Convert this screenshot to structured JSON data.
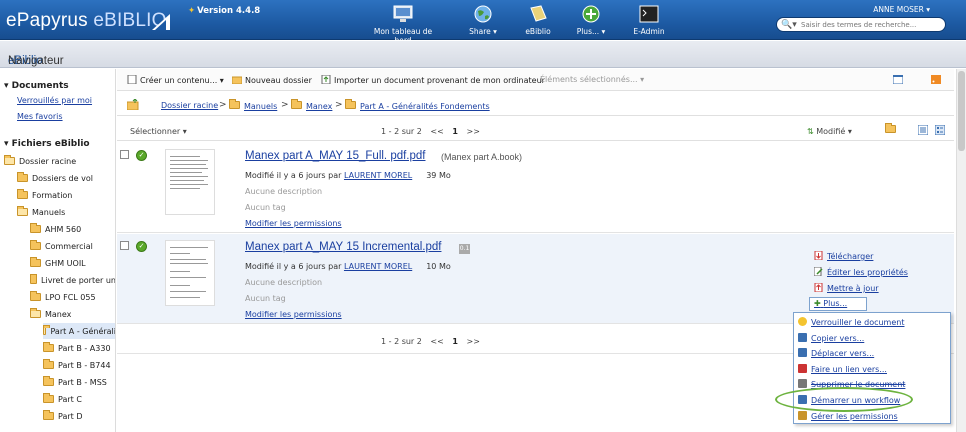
{
  "app": {
    "brand_a": "ePapyrus ",
    "brand_b": "eBIBLIO",
    "version": "Version 4.4.8"
  },
  "topnav": [
    {
      "label": "Mon tableau de bord",
      "icon": "monitor-icon"
    },
    {
      "label": "Share",
      "icon": "globe-icon"
    },
    {
      "label": "eBiblio",
      "icon": "book-icon"
    },
    {
      "label": "Plus...",
      "icon": "plus-icon"
    },
    {
      "label": "E-Admin",
      "icon": "terminal-icon"
    }
  ],
  "user": {
    "name": "ANNE MOSER"
  },
  "search": {
    "placeholder": "Saisir des termes de recherche..."
  },
  "titlebar": {
    "a": "eBiblio",
    "b": " Navigateur"
  },
  "sidebar": {
    "documents_heading": "Documents",
    "locked": "Verrouillés par moi",
    "favorites": "Mes favoris",
    "files_heading": "Fichiers eBiblio",
    "tree": [
      {
        "label": "Dossier racine",
        "depth": 0,
        "open": true
      },
      {
        "label": "Dossiers de vol",
        "depth": 1
      },
      {
        "label": "Formation",
        "depth": 1
      },
      {
        "label": "Manuels",
        "depth": 1,
        "open": true
      },
      {
        "label": "AHM 560",
        "depth": 2
      },
      {
        "label": "Commercial",
        "depth": 2
      },
      {
        "label": "GHM UOIL",
        "depth": 2
      },
      {
        "label": "Livret de porter un",
        "depth": 2
      },
      {
        "label": "LPO FCL 055",
        "depth": 2
      },
      {
        "label": "Manex",
        "depth": 2,
        "open": true
      },
      {
        "label": "Part A - Générali",
        "depth": 3,
        "open": true,
        "selected": true
      },
      {
        "label": "Part B - A330",
        "depth": 3
      },
      {
        "label": "Part B - B744",
        "depth": 3
      },
      {
        "label": "Part B - MSS",
        "depth": 3
      },
      {
        "label": "Part C",
        "depth": 3
      },
      {
        "label": "Part D",
        "depth": 3
      }
    ]
  },
  "toolbar": {
    "create": "Créer un contenu...",
    "new_folder": "Nouveau dossier",
    "import": "Importer un document provenant de mon ordinateur",
    "selected_items": "Éléments sélectionnés..."
  },
  "breadcrumb": [
    "Dossier racine",
    "Manuels",
    "Manex",
    "Part A - Généralités Fondements"
  ],
  "list": {
    "select_label": "Sélectionner",
    "pager_top": "1 - 2 sur 2",
    "prev": "<<",
    "page": "1",
    "next": ">>",
    "sort_label": "Modifié",
    "pager_bottom": "1 - 2 sur 2"
  },
  "files": [
    {
      "name": "Manex part A_MAY 15_Full. pdf.pdf",
      "extra": "(Manex part A.book)",
      "modified": "Modifié il y a 6 jours par",
      "author": "LAURENT MOREL",
      "size": "39 Mo",
      "description": "Aucune description",
      "tags": "Aucun tag",
      "permissions": "Modifier les permissions"
    },
    {
      "name": "Manex part A_MAY 15 Incremental.pdf",
      "badge": "0.1",
      "modified": "Modifié il y a 6 jours par",
      "author": "LAURENT MOREL",
      "size": "10 Mo",
      "description": "Aucune description",
      "tags": "Aucun tag",
      "permissions": "Modifier les permissions"
    }
  ],
  "actions": {
    "download": "Télécharger",
    "edit_props": "Éditer les propriétés",
    "update": "Mettre à jour",
    "more": "Plus..."
  },
  "more_menu": [
    {
      "label": "Verrouiller le document",
      "icon": "lock-icon"
    },
    {
      "label": "Copier vers...",
      "icon": "copy-icon"
    },
    {
      "label": "Déplacer vers...",
      "icon": "move-icon"
    },
    {
      "label": "Faire un lien vers...",
      "icon": "link-icon"
    },
    {
      "label": "Supprimer le document",
      "icon": "delete-icon",
      "strike": true
    },
    {
      "label": "Démarrer un workflow",
      "icon": "workflow-icon"
    },
    {
      "label": "Gérer les permissions",
      "icon": "permissions-icon"
    }
  ]
}
